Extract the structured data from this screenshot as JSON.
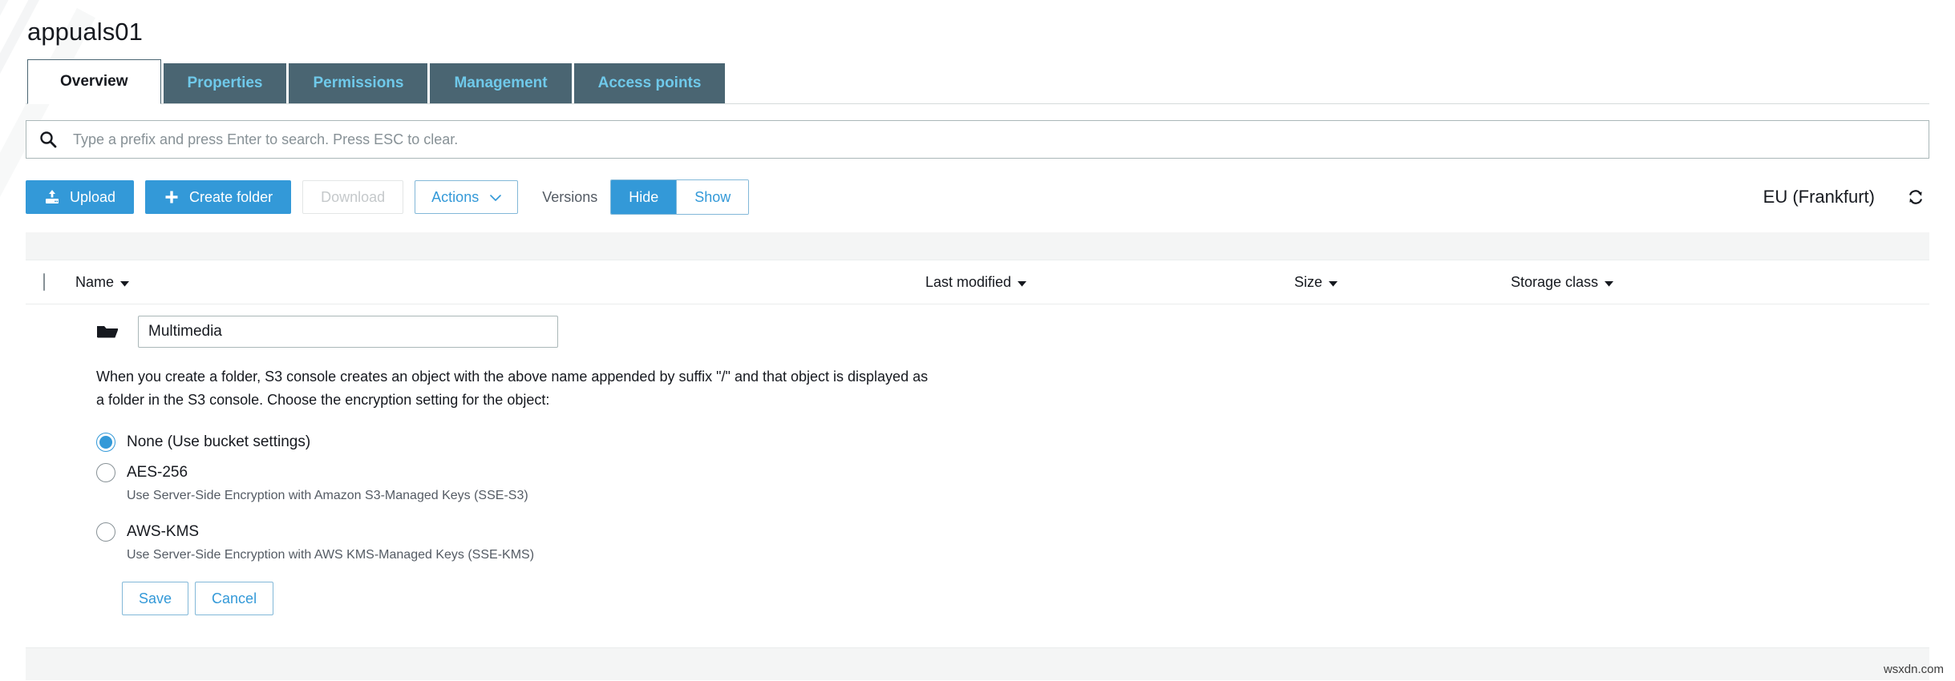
{
  "bucket": {
    "name": "appuals01"
  },
  "tabs": [
    {
      "label": "Overview",
      "active": true
    },
    {
      "label": "Properties",
      "active": false
    },
    {
      "label": "Permissions",
      "active": false
    },
    {
      "label": "Management",
      "active": false
    },
    {
      "label": "Access points",
      "active": false
    }
  ],
  "search": {
    "placeholder": "Type a prefix and press Enter to search. Press ESC to clear.",
    "value": "",
    "icon": "search-icon"
  },
  "toolbar": {
    "upload_label": "Upload",
    "upload_icon": "upload-icon",
    "create_folder_label": "Create folder",
    "create_folder_icon": "plus-icon",
    "download_label": "Download",
    "download_disabled": true,
    "actions_label": "Actions",
    "actions_caret": "chevron-down-icon",
    "versions_label": "Versions",
    "versions_hide": "Hide",
    "versions_show": "Show",
    "versions_selected": "Hide",
    "region_label": "EU (Frankfurt)",
    "refresh_icon": "refresh-icon"
  },
  "table": {
    "columns": [
      {
        "key": "name",
        "label": "Name",
        "sortable": true
      },
      {
        "key": "last_modified",
        "label": "Last modified",
        "sortable": true
      },
      {
        "key": "size",
        "label": "Size",
        "sortable": true
      },
      {
        "key": "storage_class",
        "label": "Storage class",
        "sortable": true
      }
    ],
    "select_all_checked": false,
    "rows": []
  },
  "create_folder_form": {
    "folder_icon": "folder-icon",
    "name_value": "Multimedia",
    "name_placeholder": "",
    "description": "When you create a folder, S3 console creates an object with the above name appended by suffix \"/\" and that object is displayed as a folder in the S3 console. Choose the encryption setting for the object:",
    "encryption_options": [
      {
        "label": "None (Use bucket settings)",
        "help": "",
        "selected": true
      },
      {
        "label": "AES-256",
        "help": "Use Server-Side Encryption with Amazon S3-Managed Keys (SSE-S3)",
        "selected": false
      },
      {
        "label": "AWS-KMS",
        "help": "Use Server-Side Encryption with AWS KMS-Managed Keys (SSE-KMS)",
        "selected": false
      }
    ],
    "save_label": "Save",
    "cancel_label": "Cancel"
  },
  "watermark": {
    "text": "wsxdn.com"
  },
  "colors": {
    "accent_blue": "#3399d8",
    "tab_bg": "#4a6572",
    "tab_text": "#6fc9ea",
    "strip_gray": "#f4f5f5",
    "text_dark": "#16191f",
    "text_muted": "#545b64"
  }
}
